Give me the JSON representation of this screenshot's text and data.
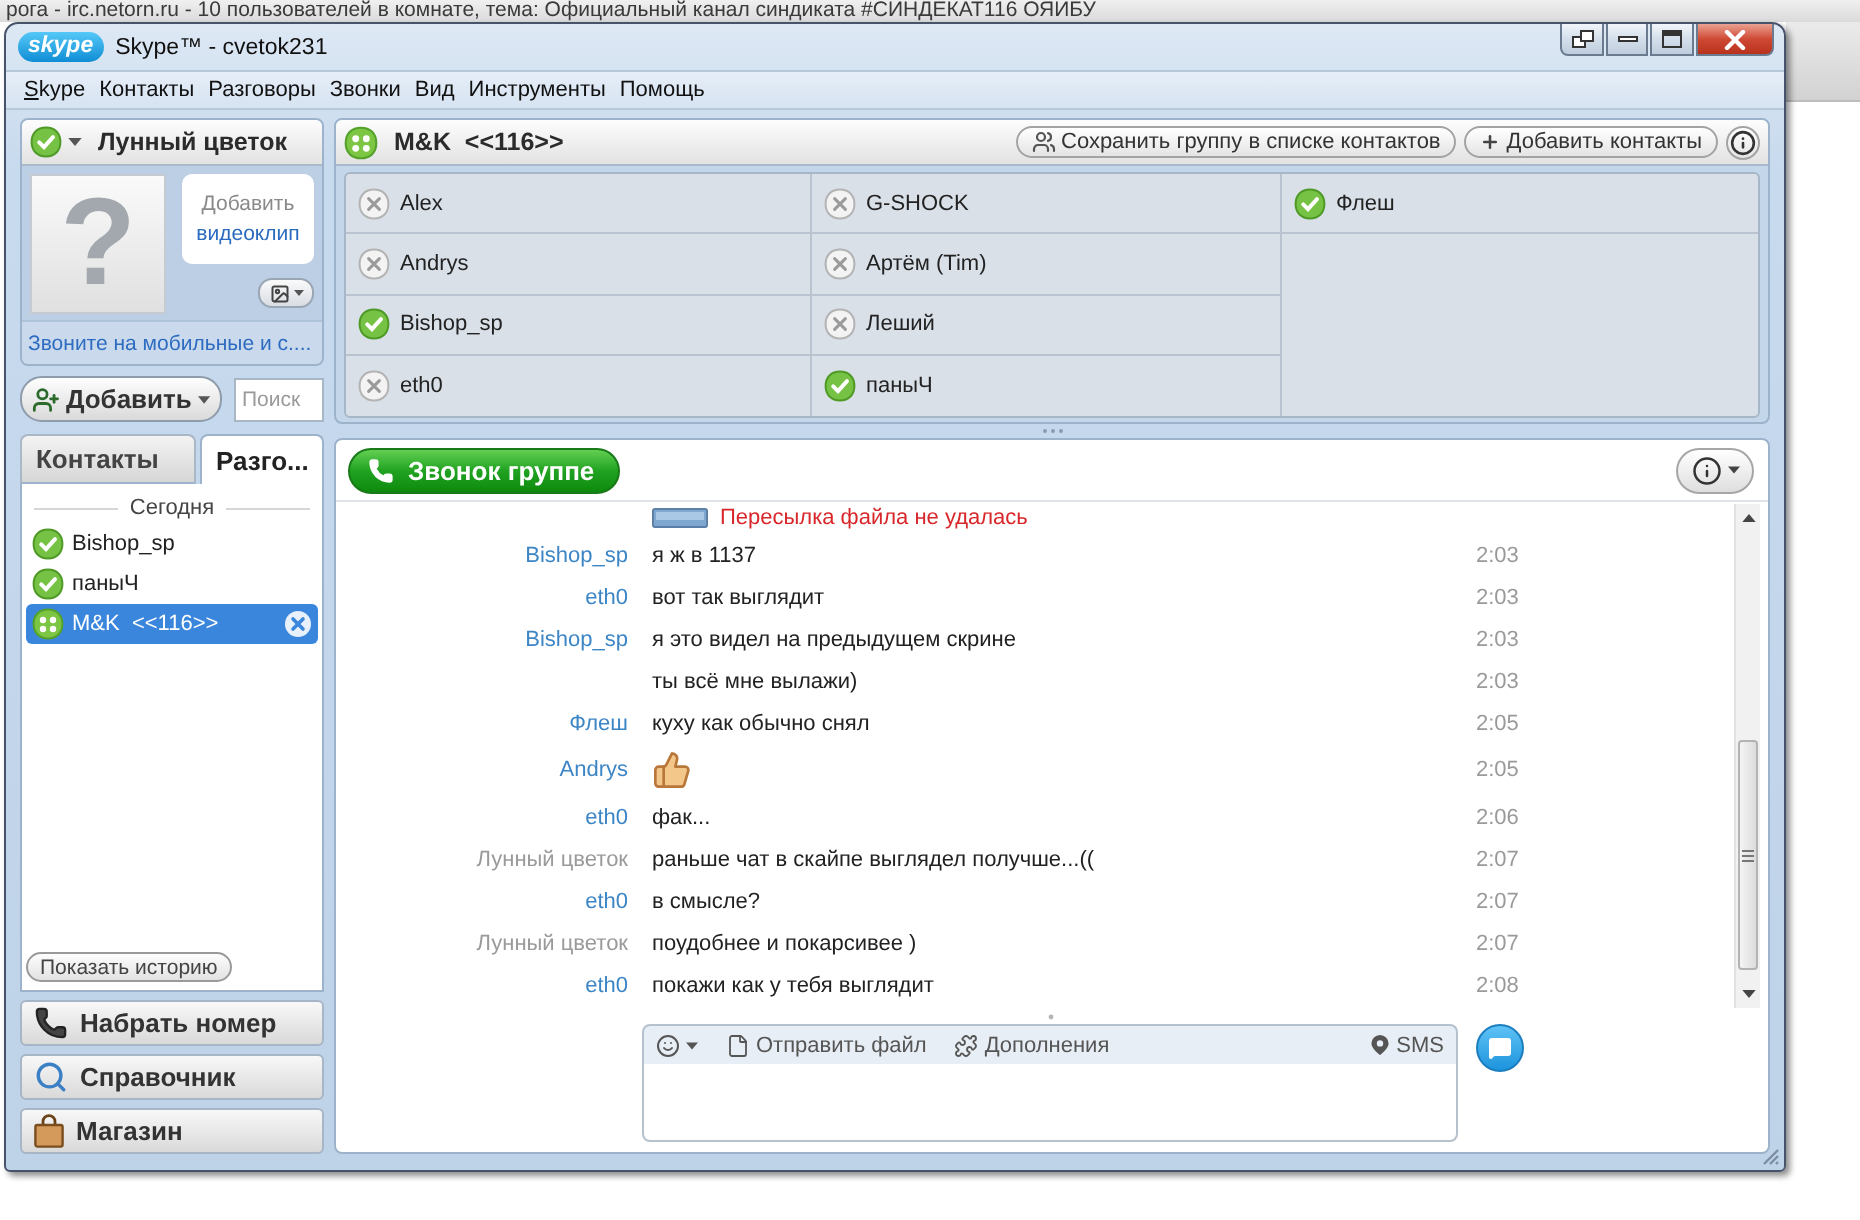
{
  "background_window": {
    "title": "рога - irc.netorn.ru - 10 пользователей в комнате, тема: Официальный канал синдиката #СИНДЕКАТ116 ОЯИБУ"
  },
  "window": {
    "logo": "skype",
    "title": "Skype™ - cvetok231"
  },
  "menu": [
    {
      "label": "Skype",
      "mnemonic": true
    },
    {
      "label": "Контакты",
      "mnemonic": false
    },
    {
      "label": "Разговоры",
      "mnemonic": false
    },
    {
      "label": "Звонки",
      "mnemonic": false
    },
    {
      "label": "Вид",
      "mnemonic": false
    },
    {
      "label": "Инструменты",
      "mnemonic": false
    },
    {
      "label": "Помощь",
      "mnemonic": false
    }
  ],
  "profile": {
    "name": "Лунный цветок",
    "online": true,
    "avatar_glyph": "?",
    "video_prompt": "Добавить",
    "video_link": "видеоклип",
    "promo_link": "Звоните на мобильные и с...."
  },
  "add_button": {
    "label": "Добавить"
  },
  "search": {
    "placeholder": "Поиск"
  },
  "tabs": [
    {
      "label": "Контакты",
      "selected": false
    },
    {
      "label": "Разго...",
      "selected": true
    }
  ],
  "recent": {
    "header": "Сегодня",
    "items": [
      {
        "name": "Bishop_sp",
        "kind": "contact",
        "online": true,
        "selected": false
      },
      {
        "name": "паныЧ",
        "kind": "contact",
        "online": true,
        "selected": false
      },
      {
        "name": "M&K  <<116>>",
        "kind": "group",
        "online": true,
        "selected": true
      }
    ],
    "history_button": "Показать историю"
  },
  "nav_buttons": [
    {
      "label": "Набрать номер",
      "kind": "dial"
    },
    {
      "label": "Справочник",
      "kind": "directory"
    },
    {
      "label": "Магазин",
      "kind": "shop"
    }
  ],
  "conversation": {
    "title": "M&K  <<116>>",
    "actions": [
      {
        "label": "Сохранить группу в списке контактов",
        "kind": "save"
      },
      {
        "label": "Добавить контакты",
        "kind": "add"
      }
    ],
    "participants": [
      {
        "name": "Alex",
        "online": false
      },
      {
        "name": "Andrys",
        "online": false
      },
      {
        "name": "Bishop_sp",
        "online": true
      },
      {
        "name": "eth0",
        "online": false
      },
      {
        "name": "G-SHOCK",
        "online": false
      },
      {
        "name": "Артём (Tim)",
        "online": false
      },
      {
        "name": "Леший",
        "online": false
      },
      {
        "name": "паныЧ",
        "online": true
      },
      {
        "name": "Флеш",
        "online": true
      }
    ]
  },
  "chat": {
    "call_button": "Звонок группе",
    "messages": [
      {
        "kind": "file_failed",
        "text": "Пересылка файла не удалась"
      },
      {
        "kind": "text",
        "sender": "Bishop_sp",
        "own": false,
        "text": "я ж в 1137",
        "time": "2:03"
      },
      {
        "kind": "text",
        "sender": "eth0",
        "own": false,
        "text": "вот так выглядит",
        "time": "2:03"
      },
      {
        "kind": "text",
        "sender": "Bishop_sp",
        "own": false,
        "text": "я это видел на предыдущем скрине",
        "time": "2:03"
      },
      {
        "kind": "text",
        "text": "ты всё мне вылажи)",
        "time": "2:03"
      },
      {
        "kind": "text",
        "sender": "Флеш",
        "own": false,
        "text": "куху как обычно снял",
        "time": "2:05"
      },
      {
        "kind": "emoticon",
        "sender": "Andrys",
        "own": false,
        "time": "2:05"
      },
      {
        "kind": "text",
        "sender": "eth0",
        "own": false,
        "text": "фак...",
        "time": "2:06"
      },
      {
        "kind": "text",
        "sender": "Лунный цветок",
        "own": true,
        "text": "раньше чат в скайпе выглядел получше...((",
        "time": "2:07"
      },
      {
        "kind": "text",
        "sender": "eth0",
        "own": false,
        "text": "в смысле?",
        "time": "2:07"
      },
      {
        "kind": "text",
        "sender": "Лунный цветок",
        "own": true,
        "text": "поудобнее и покарсивее )",
        "time": "2:07"
      },
      {
        "kind": "text",
        "sender": "eth0",
        "own": false,
        "text": "покажи как у тебя выглядит",
        "time": "2:08"
      }
    ],
    "composer": {
      "tools": [
        {
          "label": "Отправить файл",
          "kind": "file"
        },
        {
          "label": "Дополнения",
          "kind": "extras"
        }
      ],
      "sms": "SMS"
    }
  }
}
